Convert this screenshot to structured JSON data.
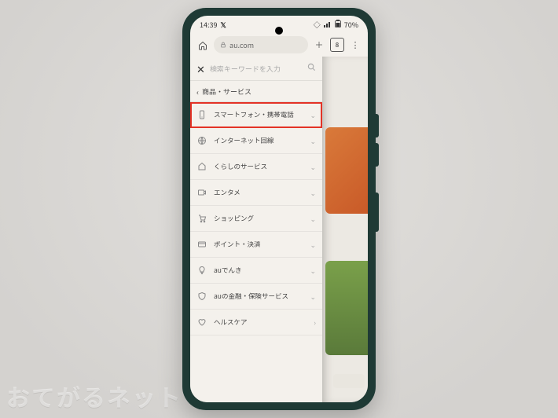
{
  "status": {
    "time": "14:39",
    "battery": "70%"
  },
  "address_bar": {
    "url": "au.com",
    "tab_count": "8"
  },
  "search": {
    "placeholder": "検索キーワードを入力"
  },
  "breadcrumb": {
    "label": "商品・サービス"
  },
  "menu": {
    "items": [
      {
        "icon": "smartphone",
        "label": "スマートフォン・携帯電話",
        "highlight": true
      },
      {
        "icon": "globe",
        "label": "インターネット回線"
      },
      {
        "icon": "home",
        "label": "くらしのサービス"
      },
      {
        "icon": "video",
        "label": "エンタメ"
      },
      {
        "icon": "cart",
        "label": "ショッピング"
      },
      {
        "icon": "card",
        "label": "ポイント・決済"
      },
      {
        "icon": "bulb",
        "label": "auでんき"
      },
      {
        "icon": "shield",
        "label": "auの金融・保険サービス"
      },
      {
        "icon": "heart",
        "label": "ヘルスケア"
      }
    ]
  },
  "watermark": "おてがるネット"
}
